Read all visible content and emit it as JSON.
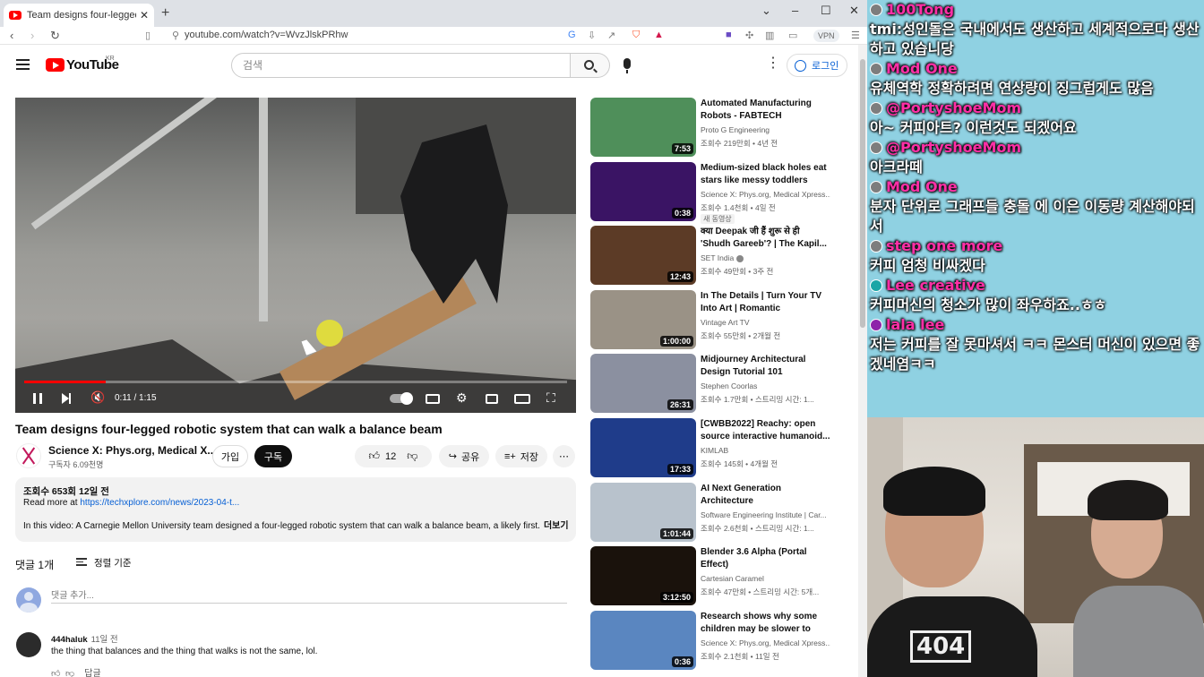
{
  "browser": {
    "tab_title": "Team designs four-legged robotic",
    "url": "youtube.com/watch?v=WvzJlskPRhw",
    "vpn": "VPN"
  },
  "youtube": {
    "logo": "YouTube",
    "logo_region": "KR",
    "search_placeholder": "검색",
    "login": "로그인"
  },
  "player": {
    "time": "0:11 / 1:15",
    "progress_fraction": 0.15
  },
  "video": {
    "title": "Team designs four-legged robotic system that can walk a balance beam",
    "channel": "Science X: Phys.org, Medical X...",
    "subscribers": "구독자 6.09천명",
    "join": "가입",
    "subscribe": "구독",
    "likes": "12",
    "share": "공유",
    "save": "저장",
    "views_date": "조회수 653회  12일 전",
    "read_more_prefix": "Read more at ",
    "read_more_link": "https://techxplore.com/news/2023-04-t...",
    "description": "In this video: A Carnegie Mellon University team designed a four-legged robotic system that can walk a balance beam, a likely first.",
    "more": "더보기"
  },
  "comments": {
    "count": "댓글 1개",
    "sort": "정렬 기준",
    "add_placeholder": "댓글 추가...",
    "items": [
      {
        "author": "444haluk",
        "time": "11일 전",
        "text": "the thing that balances and the thing that walks is not the same, lol.",
        "reply": "답글"
      }
    ]
  },
  "recommendations": [
    {
      "title": "Automated Manufacturing Robots - FABTECH",
      "channel": "Proto G Engineering",
      "meta": "조회수 219만회 • 4년 전",
      "duration": "7:53",
      "thumb_color": "#4f8f5a"
    },
    {
      "title": "Medium-sized black holes eat stars like messy toddlers",
      "channel": "Science X: Phys.org, Medical Xpress...",
      "meta": "조회수 1.4천회 • 4일 전",
      "badge": "새 동영상",
      "duration": "0:38",
      "thumb_color": "#3a1464"
    },
    {
      "title": "क्या Deepak जी हैं शुरू से ही 'Shudh Gareeb'? | The Kapil...",
      "channel": "SET India",
      "meta": "조회수 49만회 • 3주 전",
      "duration": "12:43",
      "thumb_color": "#5c3b26",
      "verified": true
    },
    {
      "title": "In The Details | Turn Your TV Into Art | Romantic Slideshow...",
      "channel": "Vintage Art TV",
      "meta": "조회수 55만회 • 2개월 전",
      "duration": "1:00:00",
      "thumb_color": "#9a9286"
    },
    {
      "title": "Midjourney Architectural Design Tutorial 101",
      "channel": "Stephen Coorlas",
      "meta": "조회수 1.7만회 • 스트리밍 시간: 1...",
      "duration": "26:31",
      "thumb_color": "#8b90a0"
    },
    {
      "title": "[CWBB2022] Reachy: open source interactive humanoid...",
      "channel": "KIMLAB",
      "meta": "조회수 145회 • 4개월 전",
      "duration": "17:33",
      "thumb_color": "#1f3c8a"
    },
    {
      "title": "AI Next Generation Architecture",
      "channel": "Software Engineering Institute | Car...",
      "meta": "조회수 2.6천회 • 스트리밍 시간: 1...",
      "duration": "1:01:44",
      "thumb_color": "#b8c2cc"
    },
    {
      "title": "Blender 3.6 Alpha (Portal Effect)",
      "channel": "Cartesian Caramel",
      "meta": "조회수 47만회 • 스트리밍 시간: 5개...",
      "duration": "3:12:50",
      "thumb_color": "#1a120c"
    },
    {
      "title": "Research shows why some children may be slower to lear...",
      "channel": "Science X: Phys.org, Medical Xpress...",
      "meta": "조회수 2.1천회 • 11일 전",
      "duration": "0:36",
      "thumb_color": "#5a86c0"
    }
  ],
  "chat": [
    {
      "name": "100Tong",
      "msg": "tmi:성인돌은 국내에서도 생산하고 세계적으로다 생산하고 있습니당",
      "icon": "gray"
    },
    {
      "name": "Mod One",
      "msg": "유체역학 정확하려면 연상량이 징그럽게도 많음",
      "icon": "gray"
    },
    {
      "name": "@PortyshoeMom",
      "msg": "아~ 커피아트? 이런것도 되겠어요",
      "icon": "gray"
    },
    {
      "name": "@PortyshoeMom",
      "msg": "아크라떼",
      "icon": "gray"
    },
    {
      "name": "Mod One",
      "msg": "분자 단위로 그래프들 충돌 에 이은 이동량 계산해야되서",
      "icon": "gray"
    },
    {
      "name": "step one more",
      "msg": "커피 엄청 비싸겠다",
      "icon": "gray"
    },
    {
      "name": "Lee creative",
      "msg": "커피머신의 청소가 많이 좌우하죠..ㅎㅎ",
      "icon": "teal"
    },
    {
      "name": "lala lee",
      "msg": "저는 커피를 잘 못마셔서 ㅋㅋ 몬스터 머신이 있으면 좋겠네염ㅋㅋ",
      "icon": "purple"
    }
  ],
  "webcam": {
    "shirt_logo": "404"
  }
}
